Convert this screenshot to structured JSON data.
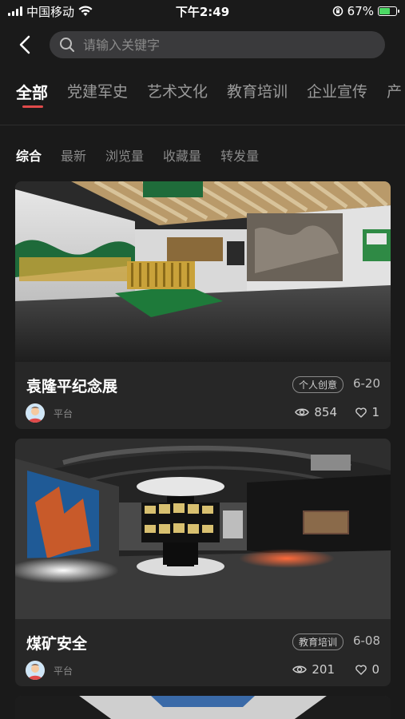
{
  "status_bar": {
    "carrier": "中国移动",
    "time": "下午2:49",
    "battery_percent": "67%",
    "battery_level": 0.67
  },
  "search": {
    "placeholder": "请输入关键字"
  },
  "category_tabs": [
    "全部",
    "党建军史",
    "艺术文化",
    "教育培训",
    "企业宣传",
    "产"
  ],
  "sort_tabs": [
    "综合",
    "最新",
    "浏览量",
    "收藏量",
    "转发量"
  ],
  "cards": [
    {
      "title": "袁隆平纪念展",
      "tag": "个人创意",
      "date": "6-20",
      "author": "平台",
      "views": "854",
      "likes": "1"
    },
    {
      "title": "煤矿安全",
      "tag": "教育培训",
      "date": "6-08",
      "author": "平台",
      "views": "201",
      "likes": "0"
    }
  ],
  "colors": {
    "background": "#1a1a1a",
    "card": "#272727",
    "accent": "#e04a4a",
    "search_bg": "#3a3a3c"
  }
}
